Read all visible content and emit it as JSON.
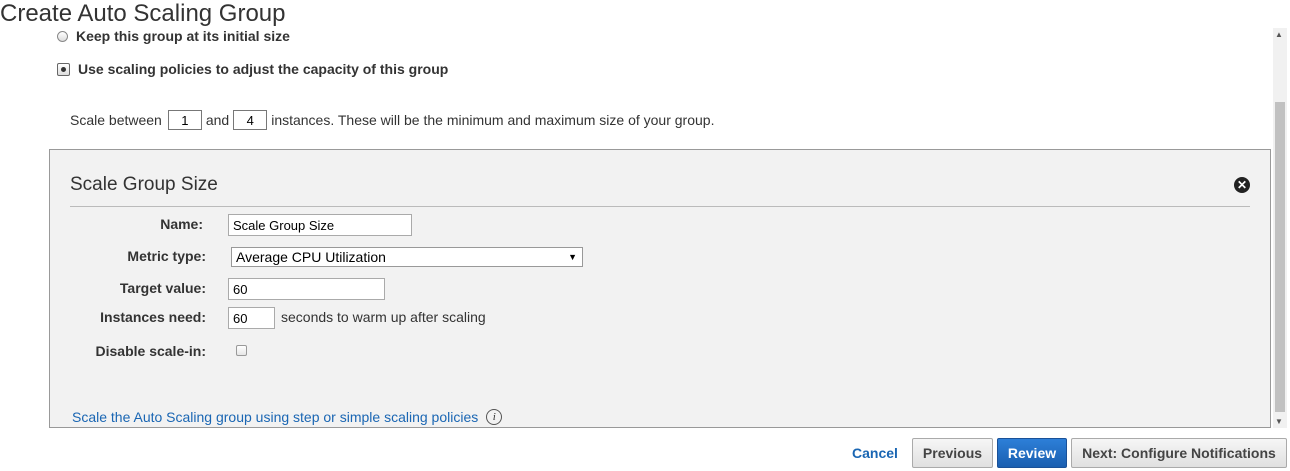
{
  "page": {
    "title": "Create Auto Scaling Group"
  },
  "options": {
    "keep_size": "Keep this group at its initial size",
    "use_policies": "Use scaling policies to adjust the capacity of this group"
  },
  "scale": {
    "prefix": "Scale between",
    "min": "1",
    "and": "and",
    "max": "4",
    "suffix": "instances. These will be the minimum and maximum size of your group."
  },
  "policy": {
    "title": "Scale Group Size",
    "name_label": "Name:",
    "name_value": "Scale Group Size",
    "metric_label": "Metric type:",
    "metric_value": "Average CPU Utilization",
    "target_label": "Target value:",
    "target_value": "60",
    "warmup_label": "Instances need:",
    "warmup_value": "60",
    "warmup_suffix": "seconds to warm up after scaling",
    "disable_label": "Disable scale-in:",
    "step_link": "Scale the Auto Scaling group using step or simple scaling policies"
  },
  "footer": {
    "cancel": "Cancel",
    "previous": "Previous",
    "review": "Review",
    "next": "Next: Configure Notifications"
  },
  "icons": {
    "close": "close-icon",
    "info": "info-icon",
    "dropdown": "chevron-down-icon"
  },
  "colors": {
    "primary_button": "#1a5fb0",
    "link": "#1a66b3",
    "panel_bg": "#f2f2f2"
  }
}
